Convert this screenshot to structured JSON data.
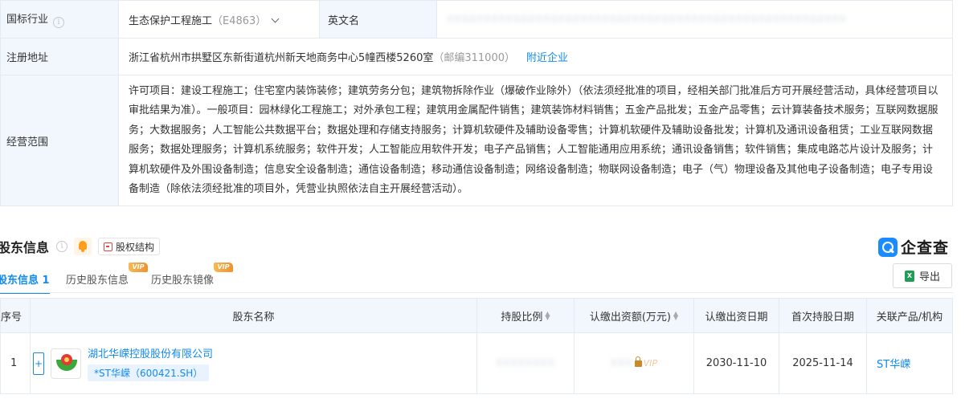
{
  "basic_info": {
    "industry_label": "国标行业",
    "industry_value": "生态保护工程施工",
    "industry_code": "（E4863）",
    "english_name_label": "英文名",
    "english_name_value": "XXXXXXXXXXXXXXXXXXXXXXXXXXXXXXXXXXXXXXXXXXXXXXXXXXXXXX",
    "address_label": "注册地址",
    "address_value": "浙江省杭州市拱墅区东新街道杭州新天地商务中心5幢西楼5260室",
    "postcode": "（邮编311000）",
    "nearby_link": "附近企业",
    "scope_label": "经营范围",
    "scope_value": "许可项目：建设工程施工；住宅室内装饰装修；建筑劳务分包；建筑物拆除作业（爆破作业除外）（依法须经批准的项目，经相关部门批准后方可开展经营活动，具体经营项目以审批结果为准）。一般项目：园林绿化工程施工；对外承包工程；建筑用金属配件销售；建筑装饰材料销售；五金产品批发；五金产品零售；云计算装备技术服务；互联网数据服务；大数据服务；人工智能公共数据平台；数据处理和存储支持服务；计算机软硬件及辅助设备零售；计算机软硬件及辅助设备批发；计算机及通讯设备租赁；工业互联网数据服务；数据处理服务；计算机系统服务；软件开发；人工智能应用软件开发；电子产品销售；人工智能通用应用系统；通讯设备销售；软件销售；集成电路芯片设计及服务；计算机软硬件及外围设备制造；信息安全设备制造；通信设备制造；移动通信设备制造；网络设备制造；物联网设备制造；电子（气）物理设备及其他电子设备制造；电子专用设备制造（除依法须经批准的项目外，凭营业执照依法自主开展经营活动）。"
  },
  "shareholder_section": {
    "title": "股东信息",
    "structure_button": "股权结构",
    "brand": "企查查",
    "tabs": [
      {
        "label": "股东信息",
        "count": "1"
      },
      {
        "label": "历史股东信息",
        "badge": "VIP"
      },
      {
        "label": "历史股东镜像",
        "badge": "VIP"
      }
    ],
    "export_label": "导出",
    "columns": [
      "序号",
      "股东名称",
      "持股比例",
      "认缴出资额(万元)",
      "认缴出资日期",
      "首次持股日期",
      "关联产品/机构"
    ],
    "rows": [
      {
        "index": "1",
        "name": "湖北华嵘控股股份有限公司",
        "tag": "*ST华嵘（600421.SH）",
        "ratio": "XXXXXXXX",
        "amount_hidden": "XXX",
        "amount_vip": "VIP",
        "subscribe_date": "2030-11-10",
        "first_hold_date": "2025-11-14",
        "related": "ST华嵘"
      }
    ]
  },
  "colors": {
    "accent": "#128bed",
    "label_bg": "#f2f7fd",
    "vip_gold": "#f0912e"
  },
  "icons": {
    "info": "info-circle-icon",
    "bell": "bell-icon",
    "structure": "equity-structure-icon",
    "export": "excel-icon",
    "lock": "lock-icon",
    "plus": "plus-icon"
  }
}
